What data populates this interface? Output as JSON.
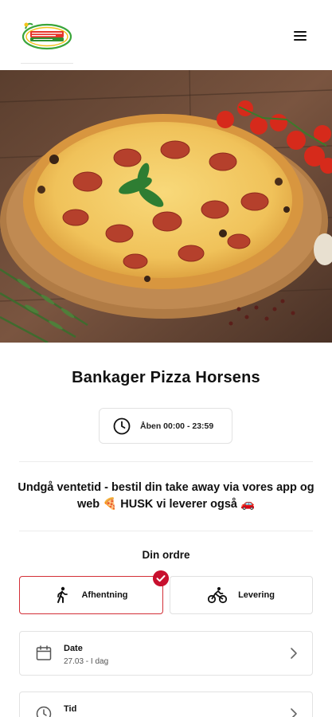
{
  "header": {
    "logo_alt": "Bankager Pizza",
    "menu_icon": "hamburger-menu-icon"
  },
  "restaurant": {
    "name": "Bankager Pizza Horsens",
    "hours": "Åben 00:00 - 23:59"
  },
  "notice": "Undgå ventetid - bestil din take away via vores app og web 🍕  HUSK vi leverer også 🚗",
  "order": {
    "title": "Din ordre",
    "options": [
      {
        "label": "Afhentning",
        "icon": "walking-person-icon",
        "selected": true
      },
      {
        "label": "Levering",
        "icon": "bicycle-icon",
        "selected": false
      }
    ],
    "date": {
      "label": "Date",
      "value": "27.03 - I dag"
    },
    "time": {
      "label": "Tid"
    }
  },
  "colors": {
    "accent": "#c8102e",
    "border": "#e2e2e2",
    "text": "#111111"
  }
}
